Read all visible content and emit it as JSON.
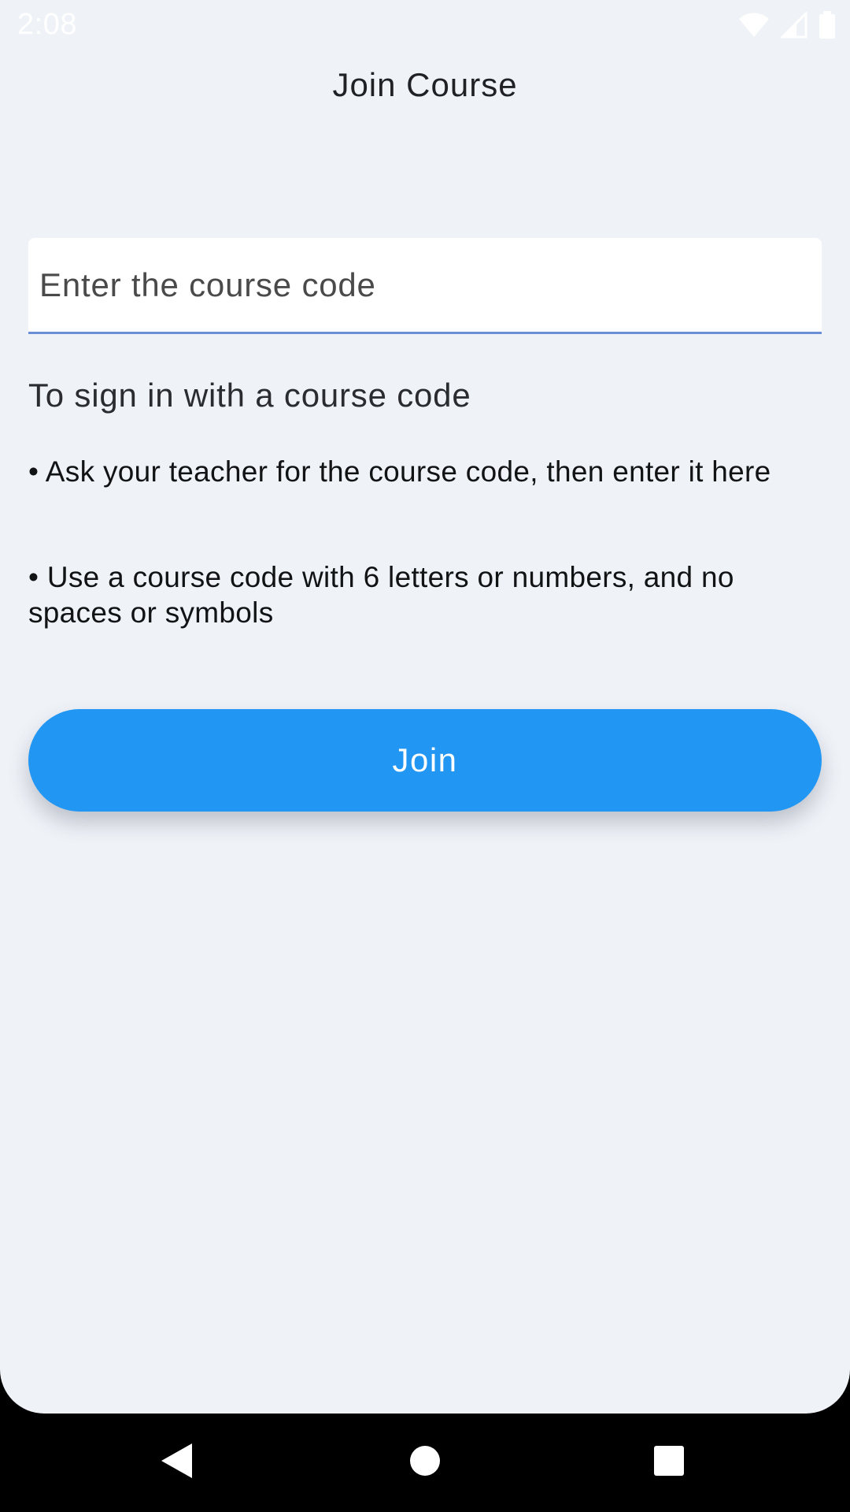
{
  "status_bar": {
    "time": "2:08",
    "icons": [
      "wifi-icon",
      "cellular-signal-icon",
      "battery-icon"
    ]
  },
  "header": {
    "title": "Join Course"
  },
  "form": {
    "code_field": {
      "value": "",
      "placeholder": "Enter the course code"
    }
  },
  "help": {
    "heading": "To sign in with a course code",
    "bullets": [
      "• Ask your teacher for the course code, then enter it here",
      "• Use a course code with 6 letters or numbers, and no spaces or symbols"
    ]
  },
  "actions": {
    "join_label": "Join"
  },
  "nav_bar": {
    "icons": [
      "back-icon",
      "home-icon",
      "recent-apps-icon"
    ]
  },
  "colors": {
    "background": "#eff2f7",
    "accent": "#2196f3",
    "field_underline": "#6b8fd6",
    "nav_bar": "#000000"
  }
}
